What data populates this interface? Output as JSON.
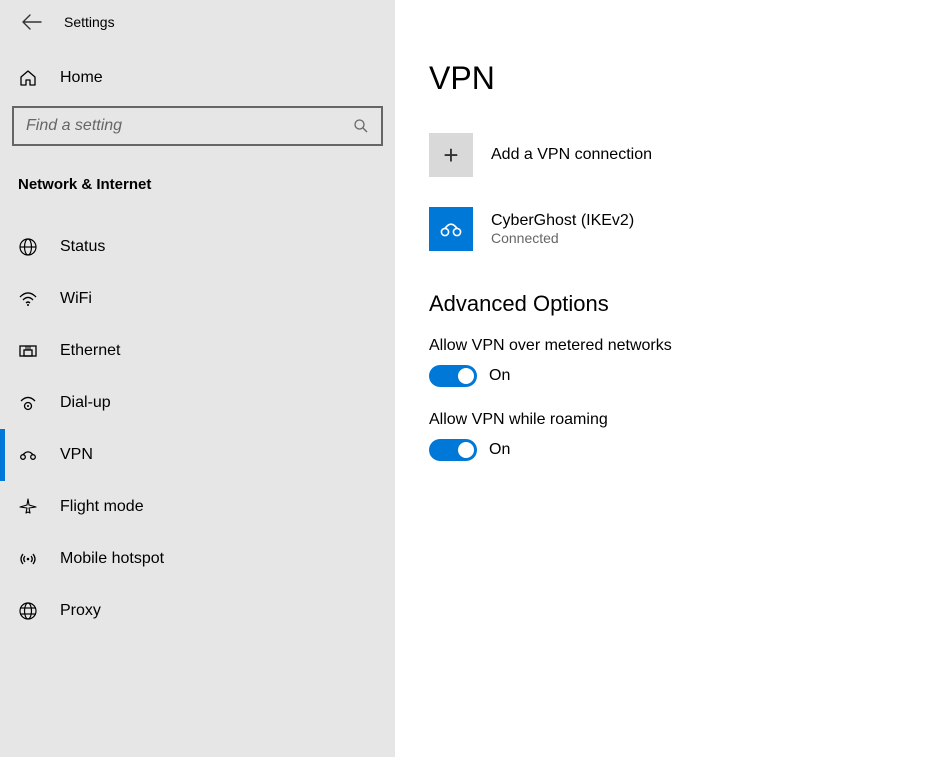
{
  "header": {
    "app_title": "Settings"
  },
  "sidebar": {
    "home_label": "Home",
    "search_placeholder": "Find a setting",
    "category": "Network & Internet",
    "items": [
      {
        "label": "Status"
      },
      {
        "label": "WiFi"
      },
      {
        "label": "Ethernet"
      },
      {
        "label": "Dial-up"
      },
      {
        "label": "VPN"
      },
      {
        "label": "Flight mode"
      },
      {
        "label": "Mobile hotspot"
      },
      {
        "label": "Proxy"
      }
    ],
    "selected": "VPN"
  },
  "main": {
    "title": "VPN",
    "add_label": "Add a VPN connection",
    "connection": {
      "name": "CyberGhost (IKEv2)",
      "status": "Connected"
    },
    "advanced_title": "Advanced Options",
    "options": [
      {
        "label": "Allow VPN over metered networks",
        "state": "On"
      },
      {
        "label": "Allow VPN while roaming",
        "state": "On"
      }
    ]
  }
}
